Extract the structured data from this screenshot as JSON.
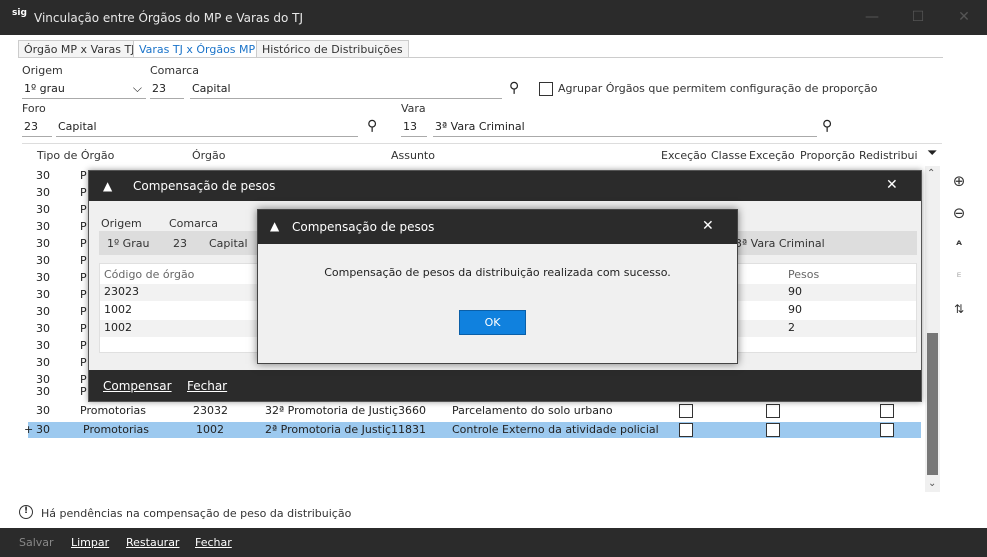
{
  "window": {
    "title": "Vinculação entre Órgãos do MP e Varas do TJ",
    "logo": "sig"
  },
  "tabs": [
    "Órgão MP x Varas TJ",
    "Varas TJ x Órgãos MP",
    "Histórico de Distribuições"
  ],
  "filters": {
    "origem_label": "Origem",
    "origem_value": "1º grau",
    "comarca_label": "Comarca",
    "comarca_code": "23",
    "comarca_name": "Capital",
    "agrupar_label": "Agrupar Órgãos que permitem configuração de proporção",
    "foro_label": "Foro",
    "foro_code": "23",
    "foro_name": "Capital",
    "vara_label": "Vara",
    "vara_code": "13",
    "vara_name": "3ª Vara Criminal"
  },
  "grid": {
    "headers": [
      "Tipo de Órgão",
      "Órgão",
      "Assunto",
      "Exceção",
      "Classe",
      "Exceção",
      "Proporção",
      "Redistribui"
    ],
    "bg_rows": [
      {
        "c1": "30",
        "c2": "P"
      },
      {
        "c1": "30",
        "c2": "P"
      },
      {
        "c1": "30",
        "c2": "P"
      },
      {
        "c1": "30",
        "c2": "P"
      },
      {
        "c1": "30",
        "c2": "P"
      },
      {
        "c1": "30",
        "c2": "P"
      },
      {
        "c1": "30",
        "c2": "P"
      },
      {
        "c1": "30",
        "c2": "P"
      },
      {
        "c1": "30",
        "c2": "P"
      },
      {
        "c1": "30",
        "c2": "P"
      },
      {
        "c1": "30",
        "c2": "P"
      },
      {
        "c1": "30",
        "c2": "P"
      },
      {
        "c1": "30",
        "c2": "P"
      },
      {
        "c1": "30",
        "c2": "P"
      }
    ],
    "row_a": {
      "c1": "30",
      "c2": "Promotorias",
      "c3": "23032",
      "c4": "32ª Promotoria de Justiç3660",
      "c5": "Parcelamento do solo urbano"
    },
    "row_b": {
      "marker": "+",
      "c1": "30",
      "c2": "Promotorias",
      "c3": "1002",
      "c4": "2ª Promotoria de Justiç11831",
      "c5": "Controle Externo da atividade policial"
    }
  },
  "dialog1": {
    "title": "Compensação de pesos",
    "origem_label": "Origem",
    "comarca_label": "Comarca",
    "origem_value": "1º Grau",
    "comarca_code": "23",
    "comarca_name": "Capital",
    "vara_name": "3ª Vara Criminal",
    "col_codigo": "Código de órgão",
    "col_pesos": "Pesos",
    "rows": [
      {
        "codigo": "23023",
        "peso": "90"
      },
      {
        "codigo": "1002",
        "peso": "90"
      },
      {
        "codigo": "1002",
        "peso": "2"
      }
    ],
    "btn_compensar": "Compensar",
    "btn_fechar": "Fechar"
  },
  "dialog2": {
    "title": "Compensação de pesos",
    "message": "Compensação de pesos da distribuição realizada com sucesso.",
    "ok": "OK"
  },
  "status": {
    "message": "Há pendências na compensação de peso da distribuição"
  },
  "footer": {
    "salvar": "Salvar",
    "limpar": "Limpar",
    "restaurar": "Restaurar",
    "fechar": "Fechar"
  },
  "colors": {
    "accent": "#1081de",
    "selected_row": "#9cc9ef",
    "titlebar": "#2b2b2b"
  }
}
